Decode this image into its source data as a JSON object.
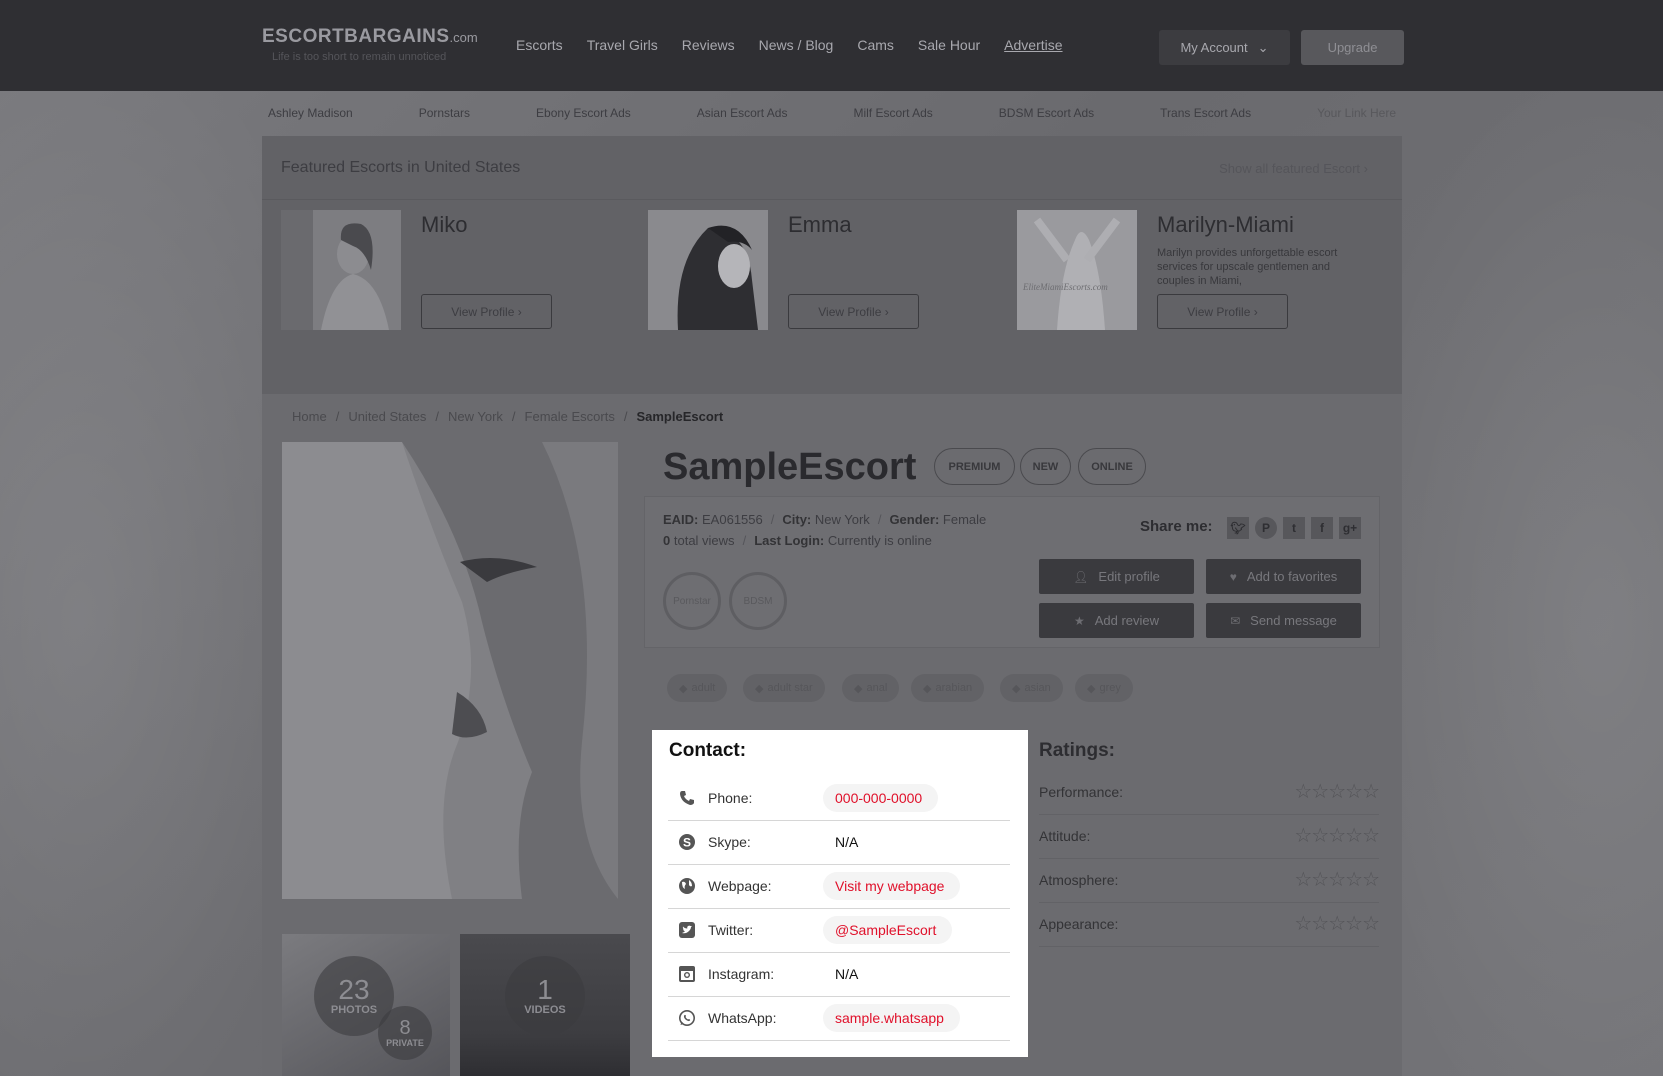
{
  "header": {
    "logo_main": "ESCORTBARGAINS",
    "logo_tld": ".com",
    "logo_tagline": "Life is too short to remain unnoticed",
    "nav": [
      "Escorts",
      "Travel Girls",
      "Reviews",
      "News / Blog",
      "Cams",
      "Sale Hour",
      "Advertise"
    ],
    "account_label": "My Account",
    "upgrade_label": "Upgrade"
  },
  "subnav": [
    "Ashley Madison",
    "Pornstars",
    "Ebony Escort Ads",
    "Asian Escort Ads",
    "Milf Escort Ads",
    "BDSM Escort Ads",
    "Trans Escort Ads",
    "Your Link Here"
  ],
  "featured": {
    "title": "Featured Escorts in United States",
    "show_all": "Show all featured Escort",
    "cards": [
      {
        "name": "Miko",
        "desc": "",
        "button": "View Profile ›"
      },
      {
        "name": "Emma",
        "desc": "",
        "button": "View Profile ›"
      },
      {
        "name": "Marilyn-Miami",
        "desc": "Marilyn provides unforgettable escort services for upscale gentlemen and couples in Miami,",
        "button": "View Profile ›",
        "watermark": "EliteMiamiEscorts.com"
      }
    ]
  },
  "breadcrumb": [
    "Home",
    "United States",
    "New York",
    "Female Escorts",
    "SampleEscort"
  ],
  "profile": {
    "name": "SampleEscort",
    "badges": [
      "PREMIUM",
      "NEW",
      "ONLINE"
    ],
    "eaid_label": "EAID:",
    "eaid": "EA061556",
    "city_label": "City:",
    "city": "New York",
    "gender_label": "Gender:",
    "gender": "Female",
    "views_count": "0",
    "views_label": "total views",
    "login_label": "Last Login:",
    "login": "Currently is online",
    "share_label": "Share me:",
    "share_icons": [
      "twitter-icon",
      "pinterest-icon",
      "tumblr-icon",
      "facebook-icon",
      "google-plus-icon"
    ],
    "categories": [
      "Pornstar",
      "BDSM"
    ],
    "actions": [
      "Edit profile",
      "Add to favorites",
      "Add review",
      "Send message"
    ],
    "tags": [
      "adult",
      "adult star",
      "anal",
      "arabian",
      "asian",
      "grey"
    ],
    "photos": {
      "count": "23",
      "label": "PHOTOS",
      "private_count": "8",
      "private_label": "PRIVATE"
    },
    "videos": {
      "count": "1",
      "label": "VIDEOS"
    }
  },
  "contact": {
    "title": "Contact:",
    "rows": [
      {
        "label": "Phone:",
        "value": "000-000-0000",
        "type": "link",
        "icon": "phone-icon"
      },
      {
        "label": "Skype:",
        "value": "N/A",
        "type": "plain",
        "icon": "skype-icon"
      },
      {
        "label": "Webpage:",
        "value": "Visit my webpage",
        "type": "link",
        "icon": "globe-icon"
      },
      {
        "label": "Twitter:",
        "value": "@SampleEscort",
        "type": "link",
        "icon": "twitter-icon"
      },
      {
        "label": "Instagram:",
        "value": "N/A",
        "type": "plain",
        "icon": "instagram-icon"
      },
      {
        "label": "WhatsApp:",
        "value": "sample.whatsapp",
        "type": "link",
        "icon": "whatsapp-icon"
      }
    ]
  },
  "ratings": {
    "title": "Ratings:",
    "rows": [
      {
        "label": "Performance:",
        "stars": 0
      },
      {
        "label": "Attitude:",
        "stars": 0
      },
      {
        "label": "Atmosphere:",
        "stars": 0
      },
      {
        "label": "Appearance:",
        "stars": 0
      }
    ]
  },
  "colors": {
    "accent_link": "#e0102a",
    "header_bg": "#2f2f33",
    "overlay": "#6e6e72"
  }
}
